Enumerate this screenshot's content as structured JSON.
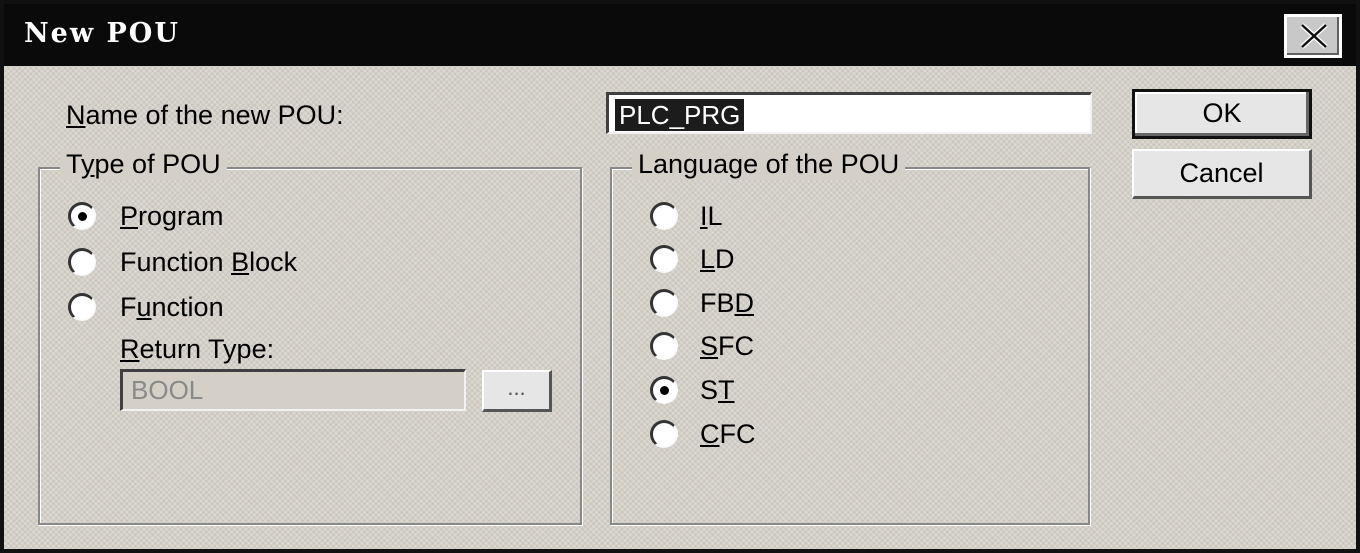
{
  "dialog": {
    "title": "New POU",
    "name_label_first": "N",
    "name_label_rest": "ame of the new POU:",
    "name_value": "PLC_PRG"
  },
  "buttons": {
    "ok": "OK",
    "cancel": "Cancel",
    "browse": "..."
  },
  "type_group": {
    "title_a": "T",
    "title_u": "y",
    "title_b": "pe of POU",
    "options": [
      {
        "pre": "",
        "u": "P",
        "post": "rogram",
        "selected": true
      },
      {
        "pre": "Function ",
        "u": "B",
        "post": "lock",
        "selected": false
      },
      {
        "pre": "F",
        "u": "u",
        "post": "nction",
        "selected": false
      }
    ],
    "return_type_label_u": "R",
    "return_type_label_rest": "eturn Type:",
    "return_type_value": "BOOL"
  },
  "lang_group": {
    "title": "Language of the POU",
    "options": [
      {
        "pre": "",
        "u": "I",
        "post": "L",
        "selected": false
      },
      {
        "pre": "",
        "u": "L",
        "post": "D",
        "selected": false
      },
      {
        "pre": "FB",
        "u": "D",
        "post": "",
        "selected": false
      },
      {
        "pre": "",
        "u": "S",
        "post": "FC",
        "selected": false
      },
      {
        "pre": "S",
        "u": "T",
        "post": "",
        "selected": true
      },
      {
        "pre": "",
        "u": "C",
        "post": "FC",
        "selected": false
      }
    ]
  }
}
